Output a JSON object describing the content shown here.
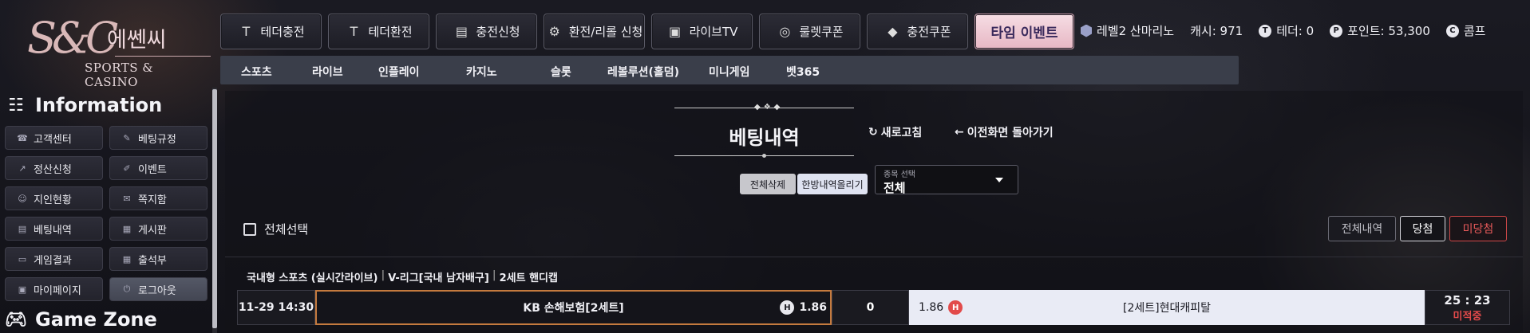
{
  "logo": {
    "kr": "에쎈씨",
    "sub": "SPORTS & CASINO"
  },
  "topnav": [
    {
      "label": "테더충전",
      "icon": "T"
    },
    {
      "label": "테더환전",
      "icon": "T"
    },
    {
      "label": "충전신청",
      "icon": "▤"
    },
    {
      "label": "환전/리롤 신청",
      "icon": "⚙"
    },
    {
      "label": "라이브TV",
      "icon": "▣"
    },
    {
      "label": "룰렛쿠폰",
      "icon": "◎"
    },
    {
      "label": "충전쿠폰",
      "icon": "◆"
    }
  ],
  "event_label": "타임 이벤트",
  "user": {
    "level": "레벨2 산마리노",
    "cash": "캐시: 971",
    "tether": "테더: 0",
    "points": "포인트: 53,300",
    "comp": "콤프"
  },
  "subnav": [
    "스포츠",
    "라이브",
    "인플레이",
    "카지노",
    "슬롯",
    "레볼루션(홀덤)",
    "미니게임",
    "벳365"
  ],
  "sidebar": {
    "info_title": "Information",
    "game_title": "Game Zone",
    "items": [
      {
        "label": "고객센터",
        "icon": "☎"
      },
      {
        "label": "베팅규정",
        "icon": "✎"
      },
      {
        "label": "정산신청",
        "icon": "↗"
      },
      {
        "label": "이벤트",
        "icon": "✐"
      },
      {
        "label": "지인현황",
        "icon": "☺"
      },
      {
        "label": "쪽지함",
        "icon": "✉"
      },
      {
        "label": "베팅내역",
        "icon": "▤"
      },
      {
        "label": "게시판",
        "icon": "▦"
      },
      {
        "label": "게임결과",
        "icon": "▭"
      },
      {
        "label": "출석부",
        "icon": "▦"
      },
      {
        "label": "마이페이지",
        "icon": "▣"
      },
      {
        "label": "로그아웃",
        "icon": "⏻"
      }
    ]
  },
  "main": {
    "title": "베팅내역",
    "refresh": "새로고침",
    "go_back": "이전화면 돌아가기",
    "delete_all": "전체삭제",
    "upload": "한방내역올리기",
    "select_label": "종목 선택",
    "select_value": "전체",
    "select_all": "전체선택",
    "filters": {
      "all": "전체내역",
      "win": "당첨",
      "lose": "미당첨"
    },
    "league": [
      "국내형 스포츠 (실시간라이브)",
      "V-리그[국내 남자배구]",
      "2세트 핸디캡"
    ],
    "bet": {
      "time": "11-29 14:30",
      "home": "KB 손해보험[2세트]",
      "home_badge": "H",
      "home_odds": "1.86",
      "handicap": "0",
      "away_odds": "1.86",
      "away_badge": "H",
      "away": "[2세트]현대캐피탈",
      "score": "25 : 23",
      "status": "미적중"
    }
  }
}
